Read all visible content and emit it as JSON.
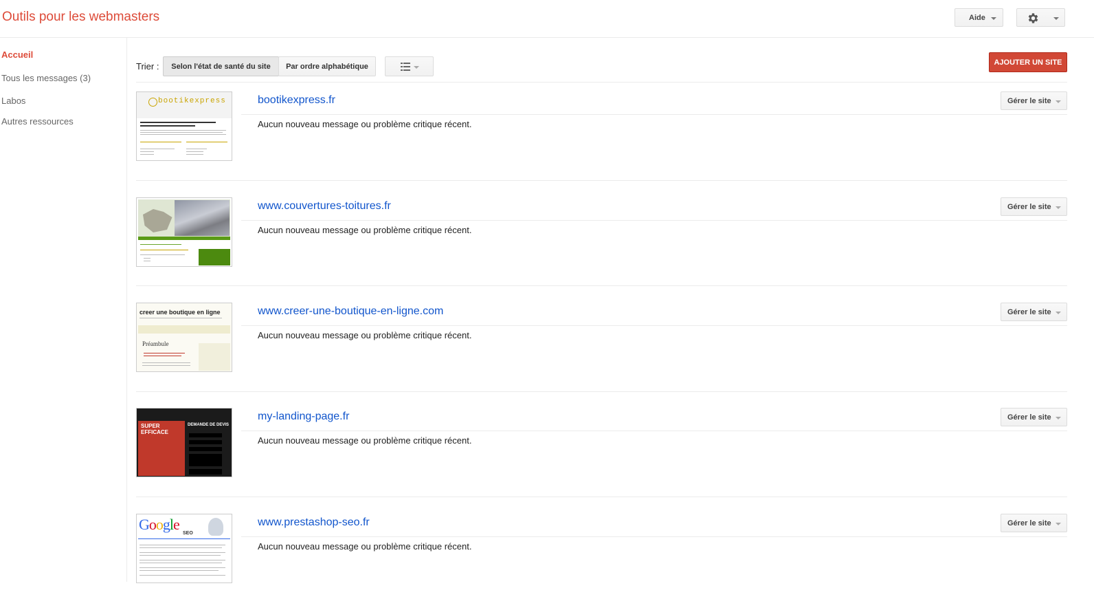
{
  "header": {
    "title": "Outils pour les webmasters",
    "help_label": "Aide",
    "settings_icon": "gear-icon"
  },
  "sidebar": {
    "items": [
      {
        "label": "Accueil",
        "active": true
      },
      {
        "label": "Tous les messages (3)",
        "active": false
      },
      {
        "label": "Labos",
        "active": false
      },
      {
        "label": "Autres ressources",
        "active": false
      }
    ]
  },
  "toolbar": {
    "sort_label": "Trier :",
    "sort_health_label": "Selon l'état de santé du site",
    "sort_alpha_label": "Par ordre alphabétique",
    "view_icon": "list-view-icon",
    "add_site_label": "AJOUTER UN SITE"
  },
  "sites": [
    {
      "url": "bootikexpress.fr",
      "status": "Aucun nouveau message ou problème critique récent.",
      "manage_label": "Gérer le site",
      "thumb_brand": "bootikexpress"
    },
    {
      "url": "www.couvertures-toitures.fr",
      "status": "Aucun nouveau message ou problème critique récent.",
      "manage_label": "Gérer le site"
    },
    {
      "url": "www.creer-une-boutique-en-ligne.com",
      "status": "Aucun nouveau message ou problème critique récent.",
      "manage_label": "Gérer le site",
      "thumb_title": "creer une boutique en ligne",
      "thumb_heading": "Préambule"
    },
    {
      "url": "my-landing-page.fr",
      "status": "Aucun nouveau message ou problème critique récent.",
      "manage_label": "Gérer le site",
      "thumb_left": "SUPER EFFICACE",
      "thumb_right": "DEMANDE DE DEVIS"
    },
    {
      "url": "www.prestashop-seo.fr",
      "status": "Aucun nouveau message ou problème critique récent.",
      "manage_label": "Gérer le site",
      "thumb_logo": "Google",
      "thumb_logo_sub": "SEO"
    }
  ],
  "colors": {
    "brand_red": "#dd4b39",
    "link_blue": "#1155cc",
    "action_red": "#d14836"
  }
}
